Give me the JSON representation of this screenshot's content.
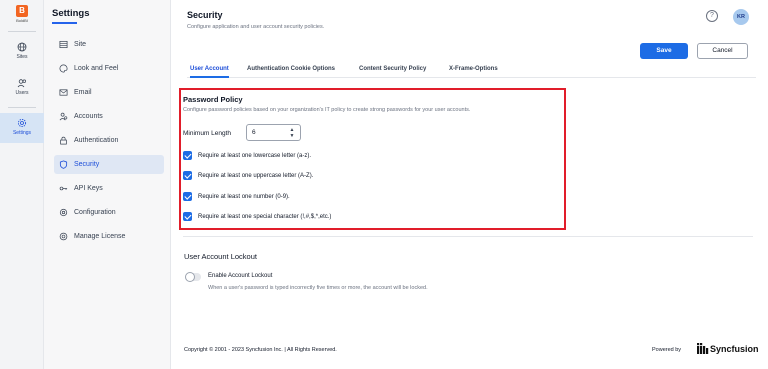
{
  "rail": {
    "brand": "BoldBI",
    "brand_letter": "B",
    "items": [
      {
        "label": "Sites",
        "icon": "globe-icon"
      },
      {
        "label": "Users",
        "icon": "users-icon"
      },
      {
        "label": "Settings",
        "icon": "gear-icon"
      }
    ]
  },
  "sidebar": {
    "title": "Settings",
    "items": [
      {
        "label": "Site",
        "icon": "site-icon"
      },
      {
        "label": "Look and Feel",
        "icon": "palette-icon"
      },
      {
        "label": "Email",
        "icon": "mail-icon"
      },
      {
        "label": "Accounts",
        "icon": "accounts-icon"
      },
      {
        "label": "Authentication",
        "icon": "lock-icon"
      },
      {
        "label": "Security",
        "icon": "shield-icon"
      },
      {
        "label": "API Keys",
        "icon": "key-icon"
      },
      {
        "label": "Configuration",
        "icon": "config-icon"
      },
      {
        "label": "Manage License",
        "icon": "license-icon"
      }
    ],
    "active_index": 5
  },
  "header": {
    "title": "Security",
    "subtitle": "Configure application and user account security policies.",
    "avatar_initials": "KR",
    "help": "?"
  },
  "actions": {
    "save": "Save",
    "cancel": "Cancel"
  },
  "tabs": [
    {
      "label": "User Account",
      "active": true
    },
    {
      "label": "Authentication Cookie Options",
      "active": false
    },
    {
      "label": "Content Security Policy",
      "active": false
    },
    {
      "label": "X-Frame-Options",
      "active": false
    }
  ],
  "password_policy": {
    "title": "Password Policy",
    "description": "Configure password policies based on your organization's IT policy to create strong passwords for your user accounts.",
    "min_length_label": "Minimum Length",
    "min_length_value": "6",
    "rules": [
      {
        "label": "Require at least one lowercase letter (a-z).",
        "checked": true
      },
      {
        "label": "Require at least one uppercase letter (A-Z).",
        "checked": true
      },
      {
        "label": "Require at least one number (0-9).",
        "checked": true
      },
      {
        "label": "Require at least one special character (!,#,$,*,etc.)",
        "checked": true
      }
    ]
  },
  "lockout": {
    "title": "User Account Lockout",
    "toggle_label": "Enable Account Lockout",
    "toggle_on": false,
    "description": "When a user's password is typed incorrectly five times or more, the account will be locked."
  },
  "footer": {
    "copyright": "Copyright © 2001 - 2023 Syncfusion Inc. | All Rights Reserved.",
    "powered_by": "Powered by",
    "brand": "Syncfusion"
  },
  "colors": {
    "accent": "#1d6ce5",
    "highlight_border": "#e11d2a",
    "brand": "#f26522"
  }
}
